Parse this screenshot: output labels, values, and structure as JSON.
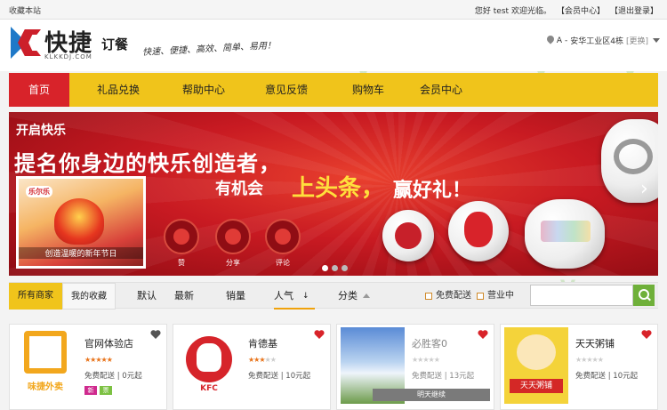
{
  "topbar": {
    "favorite": "收藏本站",
    "greeting_prefix": "您好",
    "username": "test",
    "welcome": "欢迎光临。",
    "member_center": "【会员中心】",
    "logout": "【退出登录】"
  },
  "header": {
    "logo_text": "快捷",
    "logo_domain": "KLKKDJ.COM",
    "logo_sub": "订餐",
    "slogan": "快速、便捷、高效、简单、易用！",
    "location_prefix": "A",
    "location": "安华工业区4栋",
    "location_change": "[更换]"
  },
  "nav": {
    "items": [
      "首页",
      "礼品兑换",
      "帮助中心",
      "意见反馈",
      "购物车",
      "会员中心"
    ],
    "active_index": 0
  },
  "banner": {
    "tagline": "开启快乐",
    "headline": "提名你身边的快乐创造者，",
    "sub_a": "有机会",
    "sub_highlight": "上头条，",
    "sub_b": "赢好礼！",
    "photo_brand": "乐尔乐",
    "photo_caption": "创造温暖的新年节日",
    "actions": [
      "赞",
      "分享",
      "评论"
    ],
    "slide_count": 3,
    "active_slide": 0
  },
  "filter": {
    "all_shops": "所有商家",
    "my_favorites": "我的收藏",
    "sort_options": [
      "默认",
      "最新",
      "销量",
      "人气",
      "分类"
    ],
    "active_sort": "人气",
    "checkbox_free_delivery": "免费配送",
    "checkbox_open": "营业中",
    "search_placeholder": ""
  },
  "shops": [
    {
      "name": "官网体验店",
      "logo_text": "味捷外卖",
      "rating": 5,
      "delivery": "免费配送",
      "min_order": "0元起",
      "tags": [
        "新",
        "票"
      ],
      "open": true
    },
    {
      "name": "肯德基",
      "logo_text": "KFC",
      "rating": 3,
      "delivery": "免费配送",
      "min_order": "10元起",
      "tags": [],
      "open": true
    },
    {
      "name": "必胜客0",
      "logo_text": "",
      "rating": 0,
      "delivery": "免费配送",
      "min_order": "13元起",
      "tags": [],
      "open": false,
      "closed_label": "明天继续"
    },
    {
      "name": "天天粥铺",
      "logo_text": "天天粥铺",
      "rating": 0,
      "delivery": "免费配送",
      "min_order": "10元起",
      "tags": [],
      "open": true
    }
  ],
  "colors": {
    "brand_yellow": "#f0c41b",
    "brand_red": "#d8232a",
    "search_green": "#6fb03a"
  },
  "icons": [
    "pin-icon",
    "caret-down-icon",
    "search-icon",
    "heart-icon",
    "like-icon",
    "share-icon",
    "comment-icon"
  ]
}
